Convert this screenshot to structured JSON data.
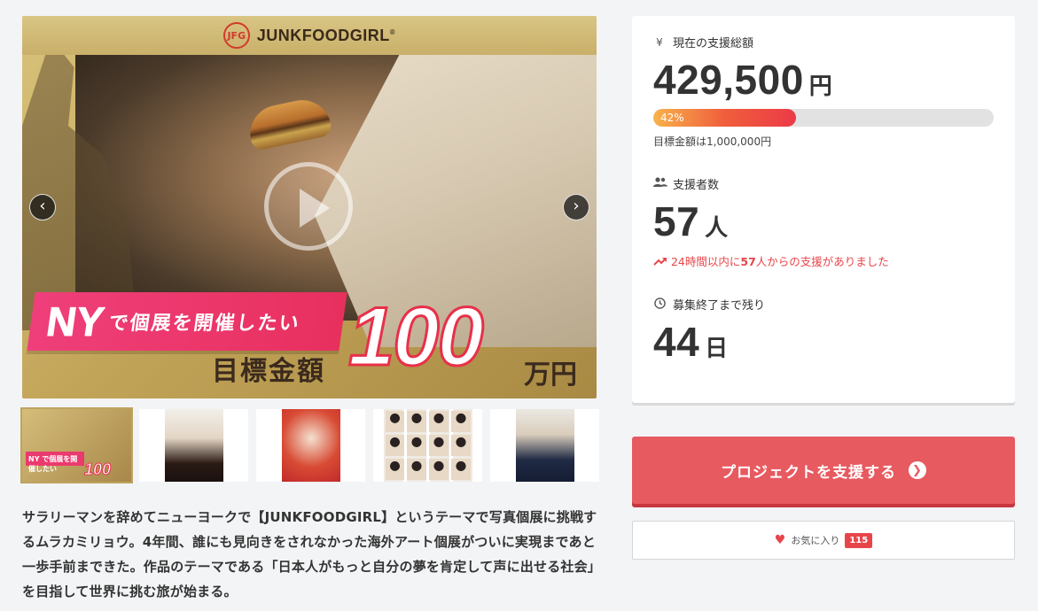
{
  "hero": {
    "brand": "JUNKFOODGIRL",
    "brand_mark": "JFG",
    "banner_big": "NY",
    "banner_small": "で個展を開催したい",
    "goal_label": "目標金額",
    "goal_number": "100",
    "goal_unit": "万円",
    "prev_icon": "chevron-left-icon",
    "next_icon": "chevron-right-icon"
  },
  "thumbnails": {
    "mini_banner": "NY で個展を開催したい",
    "mini_num": "100"
  },
  "description": "サラリーマンを辞めてニューヨークで【JUNKFOODGIRL】というテーマで写真個展に挑戦するムラカミリョウ。4年間、誰にも見向きをされなかった海外アート個展がついに実現まであと一歩手前まできた。作品のテーマである「日本人がもっと自分の夢を肯定して声に出せる社会」を目指して世界に挑む旅が始まる。",
  "stats": {
    "total_label": "現在の支援総額",
    "total_amount": "429,500",
    "total_unit": "円",
    "progress_percent": 42,
    "progress_label": "42%",
    "goal_note": "目標金額は1,000,000円",
    "supporters_label": "支援者数",
    "supporters_count": "57",
    "supporters_unit": "人",
    "trend_prefix": "24時間以内に",
    "trend_count": "57",
    "trend_suffix": "人からの支援がありました",
    "remaining_label": "募集終了まで残り",
    "remaining_days": "44",
    "remaining_unit": "日"
  },
  "actions": {
    "support_label": "プロジェクトを支援する",
    "favorite_label": "お気に入り",
    "favorite_count": "115"
  },
  "colors": {
    "accent": "#e75a60",
    "trend": "#e8454a",
    "hero_gold": "#c2a458"
  }
}
